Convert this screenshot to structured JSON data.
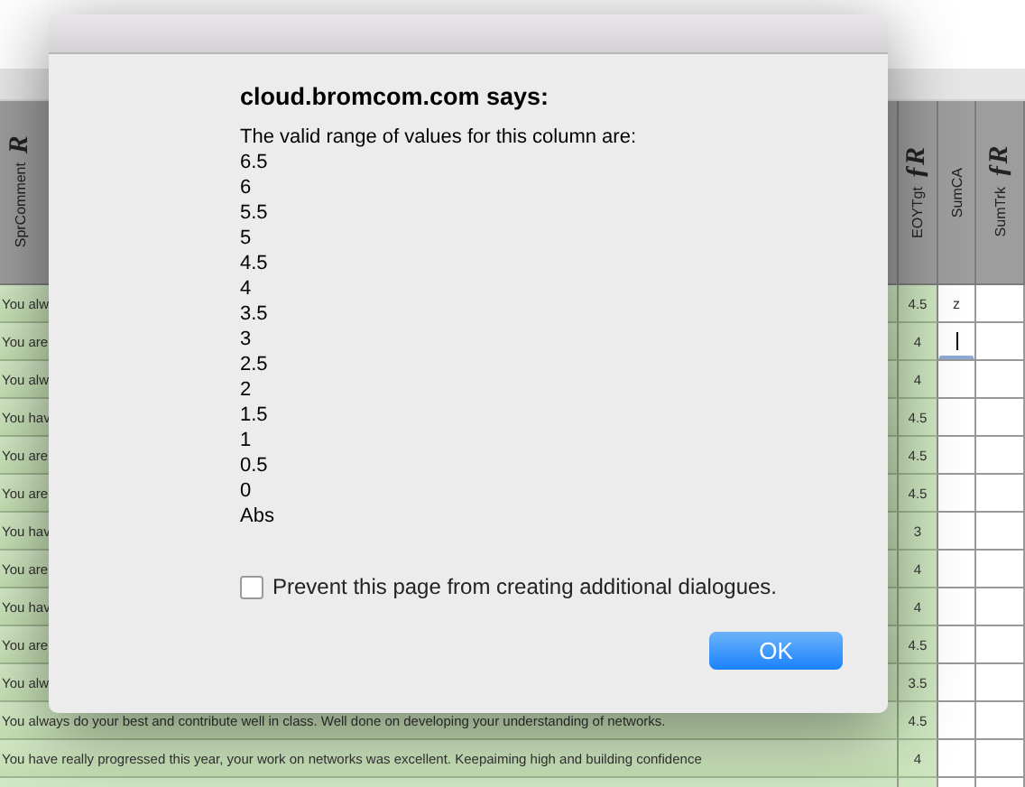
{
  "table": {
    "columns": [
      {
        "label": "SprComment",
        "mark": "R"
      },
      {
        "label": "EOYTgt",
        "mark": "ƒR"
      },
      {
        "label": "SumCA"
      },
      {
        "label": "SumTrk",
        "mark": "ƒR"
      }
    ],
    "rows": [
      {
        "comment": "You alw",
        "target": "4.5",
        "sumca": "z",
        "editing": false
      },
      {
        "comment": "You are",
        "target": "4",
        "editing": true
      },
      {
        "comment": "You alw",
        "target": "4",
        "editing": false
      },
      {
        "comment": "You hav",
        "target": "4.5",
        "editing": false
      },
      {
        "comment": "You are",
        "target": "4.5",
        "editing": false
      },
      {
        "comment": "You are",
        "target": "4.5",
        "editing": false
      },
      {
        "comment": "You hav",
        "target": "3",
        "editing": false
      },
      {
        "comment": "You are",
        "target": "4",
        "editing": false
      },
      {
        "comment": "You hav",
        "target": "4",
        "editing": false
      },
      {
        "comment": "You are",
        "target": "4.5",
        "editing": false
      },
      {
        "comment": "You alw",
        "target": "3.5",
        "editing": false
      },
      {
        "comment": "You always do your best and contribute well in class. Well done on developing your understanding of networks.",
        "target": "4.5",
        "editing": false
      },
      {
        "comment": "You have really progressed this year, your work on networks was excellent. Keepaiming high and building confidence",
        "target": "4",
        "editing": false
      }
    ]
  },
  "dialog": {
    "title": "cloud.bromcom.com says:",
    "message": "The valid range of values for this column are:",
    "values": [
      "6.5",
      "6",
      "5.5",
      "5",
      "4.5",
      "4",
      "3.5",
      "3",
      "2.5",
      "2",
      "1.5",
      "1",
      "0.5",
      "0",
      "Abs"
    ],
    "checkbox": {
      "label": "Prevent this page from creating additional dialogues.",
      "checked": false
    },
    "button": "OK"
  }
}
